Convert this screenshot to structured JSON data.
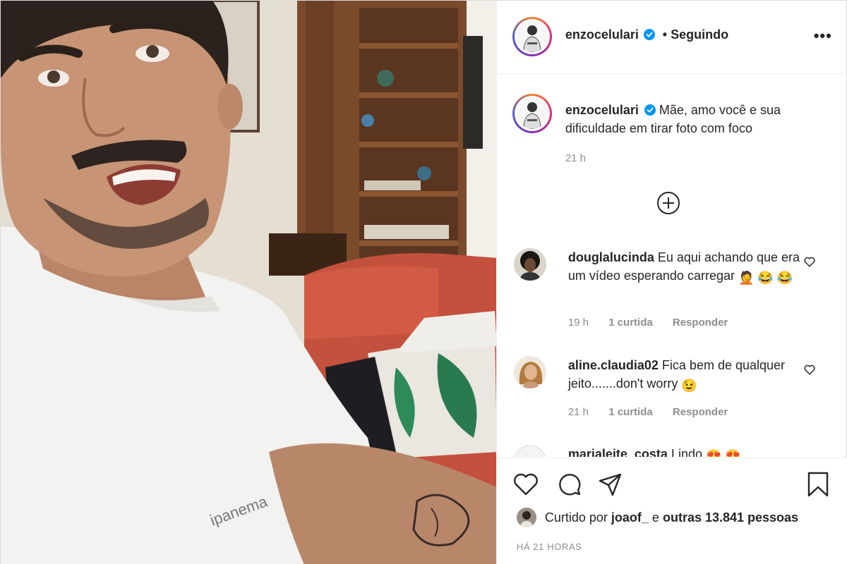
{
  "post": {
    "author": "enzocelulari",
    "follow_status": "• Seguindo",
    "more_label": "•••"
  },
  "caption": {
    "username": "enzocelulari",
    "text": "Mãe, amo você e sua dificuldade em tirar foto com foco",
    "time": "21 h"
  },
  "load_more_icon": "plus-circle-icon",
  "comments": [
    {
      "username": "douglalucinda",
      "text": "Eu aqui achando que era um vídeo esperando carregar",
      "emojis": "🤦 😂 😂",
      "time": "19 h",
      "likes": "1 curtida",
      "reply": "Responder"
    },
    {
      "username": "aline.claudia02",
      "text": "Fica bem de qualquer jeito.......don't worry",
      "emojis": "😉",
      "time": "21 h",
      "likes": "1 curtida",
      "reply": "Responder"
    },
    {
      "username": "marialeite_costa",
      "text": "Lindo",
      "emojis": "😍 😍"
    }
  ],
  "likes": {
    "prefix": "Curtido por",
    "user": "joaof_",
    "connector": "e",
    "others": "outras 13.841 pessoas"
  },
  "timestamp": "HÁ 21 HORAS",
  "colors": {
    "verified": "#0095f6",
    "text": "#262626",
    "muted": "#8e8e8e",
    "sofa": "#c4503e"
  }
}
